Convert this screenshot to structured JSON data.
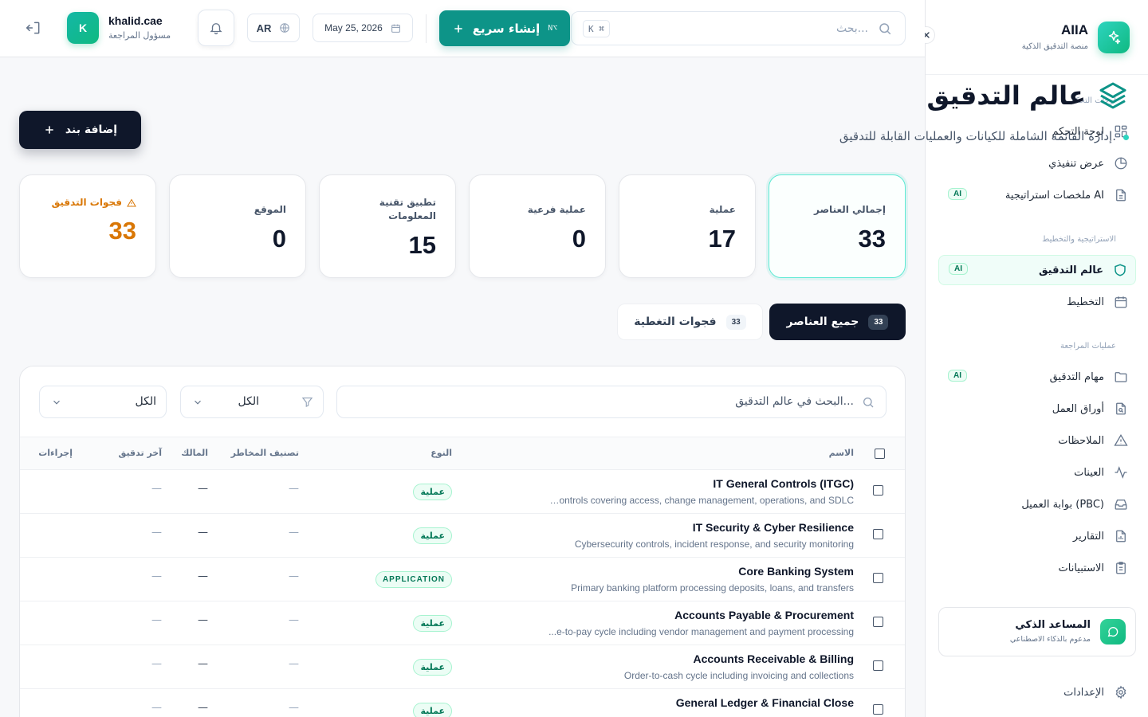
{
  "sidebar": {
    "app_name": "AIIA",
    "app_sub": "منصة التدقيق الذكية",
    "sections": [
      {
        "title": "لوحات التحكم",
        "items": [
          {
            "label": "لوحة التحكم",
            "icon": "grid-icon",
            "ai": ""
          },
          {
            "label": "عرض تنفيذي",
            "icon": "pie-chart-icon",
            "ai": ""
          },
          {
            "label": "ملخصات استراتيجية AI",
            "icon": "document-icon",
            "ai": "AI"
          }
        ]
      },
      {
        "title": "الاستراتيجية والتخطيط",
        "items": [
          {
            "label": "عالم التدقيق",
            "icon": "shield-icon",
            "ai": "AI",
            "active": true
          },
          {
            "label": "التخطيط",
            "icon": "calendar-icon",
            "ai": ""
          }
        ]
      },
      {
        "title": "عمليات المراجعة",
        "items": [
          {
            "label": "مهام التدقيق",
            "icon": "folder-icon",
            "ai": "AI"
          },
          {
            "label": "أوراق العمل",
            "icon": "file-search-icon",
            "ai": ""
          },
          {
            "label": "الملاحظات",
            "icon": "warning-icon",
            "ai": ""
          },
          {
            "label": "العينات",
            "icon": "activity-icon",
            "ai": ""
          },
          {
            "label": "بوابة العميل (PBC)",
            "icon": "inbox-icon",
            "ai": ""
          },
          {
            "label": "التقارير",
            "icon": "report-icon",
            "ai": ""
          },
          {
            "label": "الاستبيانات",
            "icon": "clipboard-icon",
            "ai": ""
          }
        ]
      }
    ],
    "assistant": {
      "title": "المساعد الذكي",
      "subtitle": "مدعوم بالذكاء الاصطناعي"
    },
    "settings_label": "الإعدادات"
  },
  "topbar": {
    "search_placeholder": "بحث...",
    "search_shortcut": "K ⌘",
    "quick_create_label": "إنشاء سريع",
    "quick_create_shortcut": "N⌥",
    "date": "May 25, 2026",
    "language": "AR",
    "user": {
      "initial": "K",
      "name": "khalid.cae",
      "role": "مسؤول المراجعة"
    }
  },
  "page": {
    "title": "عالم التدقيق",
    "subtitle": "إدارة القائمة الشاملة للكيانات والعمليات القابلة للتدقيق.",
    "add_button": "إضافة بند"
  },
  "stats": [
    {
      "label": "إجمالي العناصر",
      "value": "33"
    },
    {
      "label": "عملية",
      "value": "17"
    },
    {
      "label": "عملية فرعية",
      "value": "0"
    },
    {
      "label": "تطبيق تقنية المعلومات",
      "value": "15"
    },
    {
      "label": "الموقع",
      "value": "0"
    },
    {
      "label": "فجوات التدقيق",
      "value": "33"
    }
  ],
  "tabs": [
    {
      "label": "جميع العناصر",
      "count": "33"
    },
    {
      "label": "فجوات التغطية",
      "count": "33"
    }
  ],
  "table": {
    "search_placeholder": "البحث في عالم التدقيق...",
    "filter_type_value": "الكل",
    "filter_risk_value": "الكل",
    "columns": [
      "الاسم",
      "النوع",
      "تصنيف المخاطر",
      "المالك",
      "آخر تدقيق",
      "إجراءات"
    ],
    "rows": [
      {
        "name": "IT General Controls (ITGC)",
        "desc": "controls covering access, change management, operations, and SDLC ...",
        "type": "عملية",
        "risk": "—",
        "owner": "—",
        "last_audit": "—"
      },
      {
        "name": "IT Security & Cyber Resilience",
        "desc": "Cybersecurity controls, incident response, and security monitoring",
        "type": "عملية",
        "risk": "—",
        "owner": "—",
        "last_audit": "—"
      },
      {
        "name": "Core Banking System",
        "desc": "Primary banking platform processing deposits, loans, and transfers",
        "type": "APPLICATION",
        "risk": "—",
        "owner": "—",
        "last_audit": "—"
      },
      {
        "name": "Accounts Payable & Procurement",
        "desc": "e-to-pay cycle including vendor management and payment processing...",
        "type": "عملية",
        "risk": "—",
        "owner": "—",
        "last_audit": "—"
      },
      {
        "name": "Accounts Receivable & Billing",
        "desc": "Order-to-cash cycle including invoicing and collections",
        "type": "عملية",
        "risk": "—",
        "owner": "—",
        "last_audit": "—"
      },
      {
        "name": "General Ledger & Financial Close",
        "desc": "",
        "type": "عملية",
        "risk": "—",
        "owner": "—",
        "last_audit": "—"
      }
    ]
  },
  "colors": {
    "accent": "#0d9488",
    "dark": "#0f172a",
    "warning": "#d97706"
  }
}
